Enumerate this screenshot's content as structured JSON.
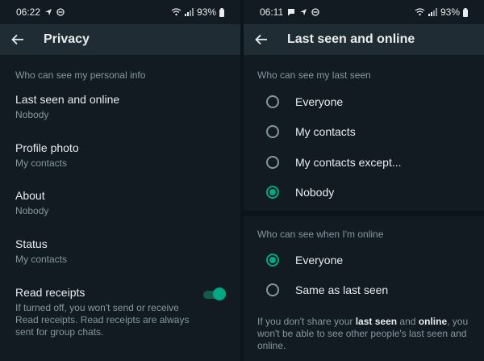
{
  "left": {
    "status": {
      "time": "06:22",
      "battery": "93%"
    },
    "title": "Privacy",
    "section": "Who can see my personal info",
    "items": [
      {
        "title": "Last seen and online",
        "sub": "Nobody"
      },
      {
        "title": "Profile photo",
        "sub": "My contacts"
      },
      {
        "title": "About",
        "sub": "Nobody"
      },
      {
        "title": "Status",
        "sub": "My contacts"
      }
    ],
    "read_receipts": {
      "title": "Read receipts",
      "desc": "If turned off, you won't send or receive Read receipts. Read receipts are always sent for group chats.",
      "enabled": true
    }
  },
  "right": {
    "status": {
      "time": "06:11",
      "battery": "93%"
    },
    "title": "Last seen and online",
    "last_seen": {
      "heading": "Who can see my last seen",
      "options": [
        "Everyone",
        "My contacts",
        "My contacts except...",
        "Nobody"
      ],
      "selected": "Nobody"
    },
    "online": {
      "heading": "Who can see when I'm online",
      "options": [
        "Everyone",
        "Same as last seen"
      ],
      "selected": "Everyone"
    },
    "note": {
      "p1": "If you don't share your ",
      "b1": "last seen",
      "p2": " and ",
      "b2": "online",
      "p3": ", you won't be able to see other people's last seen and online."
    }
  },
  "colors": {
    "accent": "#00a884",
    "background": "#111b21",
    "appbar": "#202c33",
    "secondary_text": "#8696a0"
  }
}
